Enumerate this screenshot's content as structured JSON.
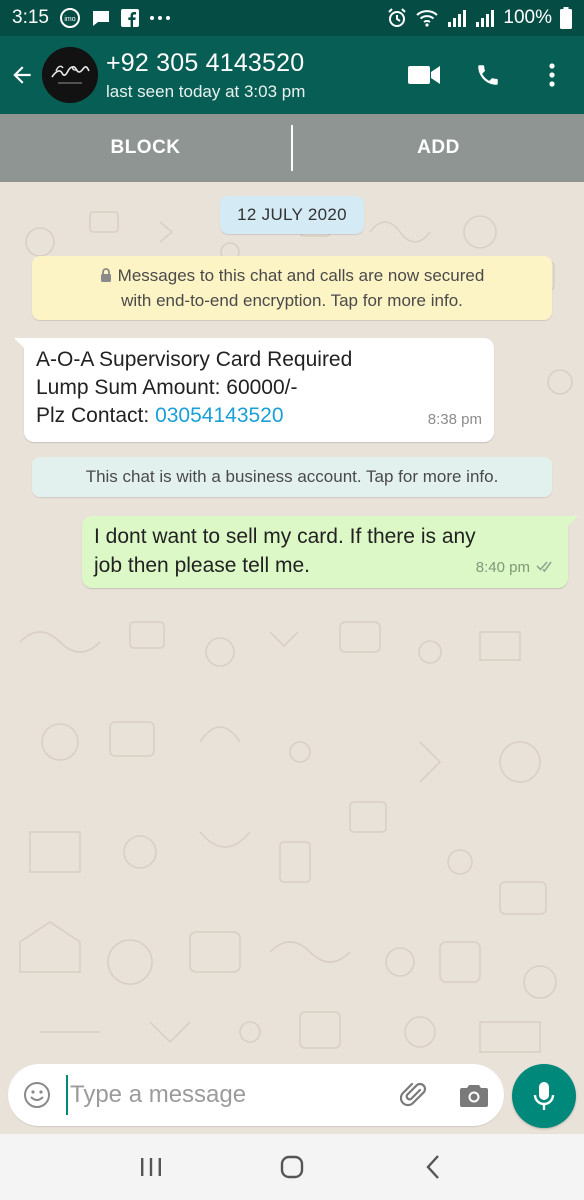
{
  "status_bar": {
    "time": "3:15",
    "battery": "100%",
    "left_icons": [
      "imo-icon",
      "chat-bubble-icon",
      "facebook-icon",
      "more-dots-icon"
    ],
    "right_icons": [
      "alarm-icon",
      "wifi-icon",
      "signal-icon",
      "signal-icon-2"
    ]
  },
  "header": {
    "contact_name": "+92 305 4143520",
    "last_seen": "last seen today at 3:03 pm",
    "icons": [
      "back-arrow-icon",
      "avatar",
      "video-call-icon",
      "phone-icon",
      "menu-icon"
    ]
  },
  "block_bar": {
    "block_label": "BLOCK",
    "add_label": "ADD"
  },
  "chat": {
    "date_chip": "12 JULY 2020",
    "encryption_notice": {
      "line1": "Messages to this chat and calls are now secured",
      "line2": "with end-to-end encryption. Tap for more info."
    },
    "incoming_message": {
      "line1": "A-O-A Supervisory Card Required",
      "line2": "Lump Sum Amount: 60000/-",
      "line3_prefix": "Plz Contact: ",
      "phone_link": "03054143520",
      "time": "8:38 pm"
    },
    "business_notice": "This chat is with a business account. Tap for more info.",
    "outgoing_message": {
      "line1": "I dont want to sell my card. If there is any",
      "line2": "job then please tell me.",
      "time": "8:40 pm",
      "status": "delivered"
    }
  },
  "composer": {
    "placeholder": "Type a message",
    "icons": [
      "emoji-icon",
      "attach-icon",
      "camera-icon",
      "mic-icon"
    ]
  },
  "navigation": {
    "icons": [
      "recent-apps-icon",
      "home-icon",
      "back-icon"
    ]
  },
  "colors": {
    "header": "#075e54",
    "status_bar": "#054d44",
    "incoming_bubble": "#ffffff",
    "outgoing_bubble": "#dcf8c6",
    "link": "#1a9fd8",
    "accent": "#00897b"
  }
}
